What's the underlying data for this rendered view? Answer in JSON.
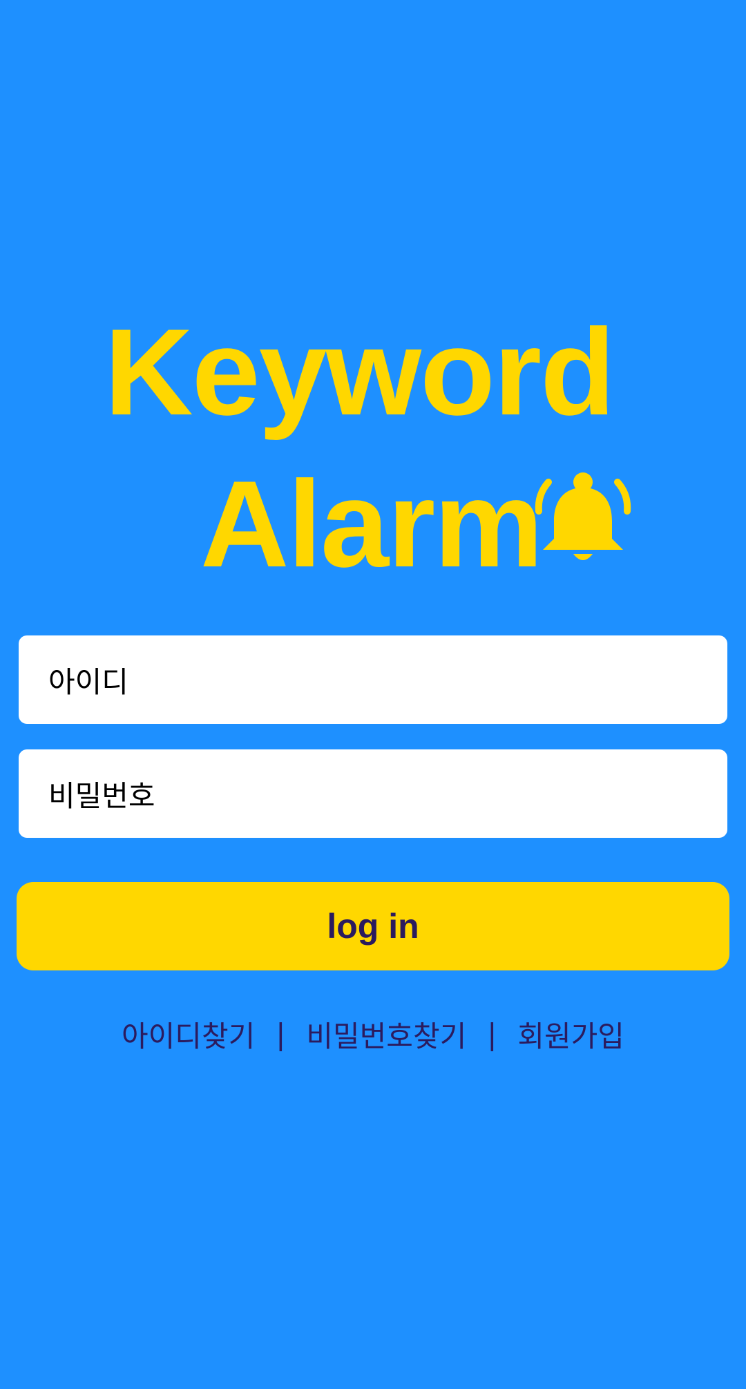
{
  "app": {
    "title_line1": "Keyword",
    "title_line2": "Alarm",
    "title_icon": "bell-ringing-icon"
  },
  "form": {
    "id_placeholder": "아이디",
    "password_placeholder": "비밀번호",
    "login_label": "log in"
  },
  "links": {
    "find_id": "아이디찾기",
    "separator": "|",
    "find_password": "비밀번호찾기",
    "signup": "회원가입"
  },
  "colors": {
    "background": "#1E90FF",
    "accent": "#FFD700",
    "link_text": "#2B1B5E",
    "input_bg": "#FFFFFF"
  }
}
